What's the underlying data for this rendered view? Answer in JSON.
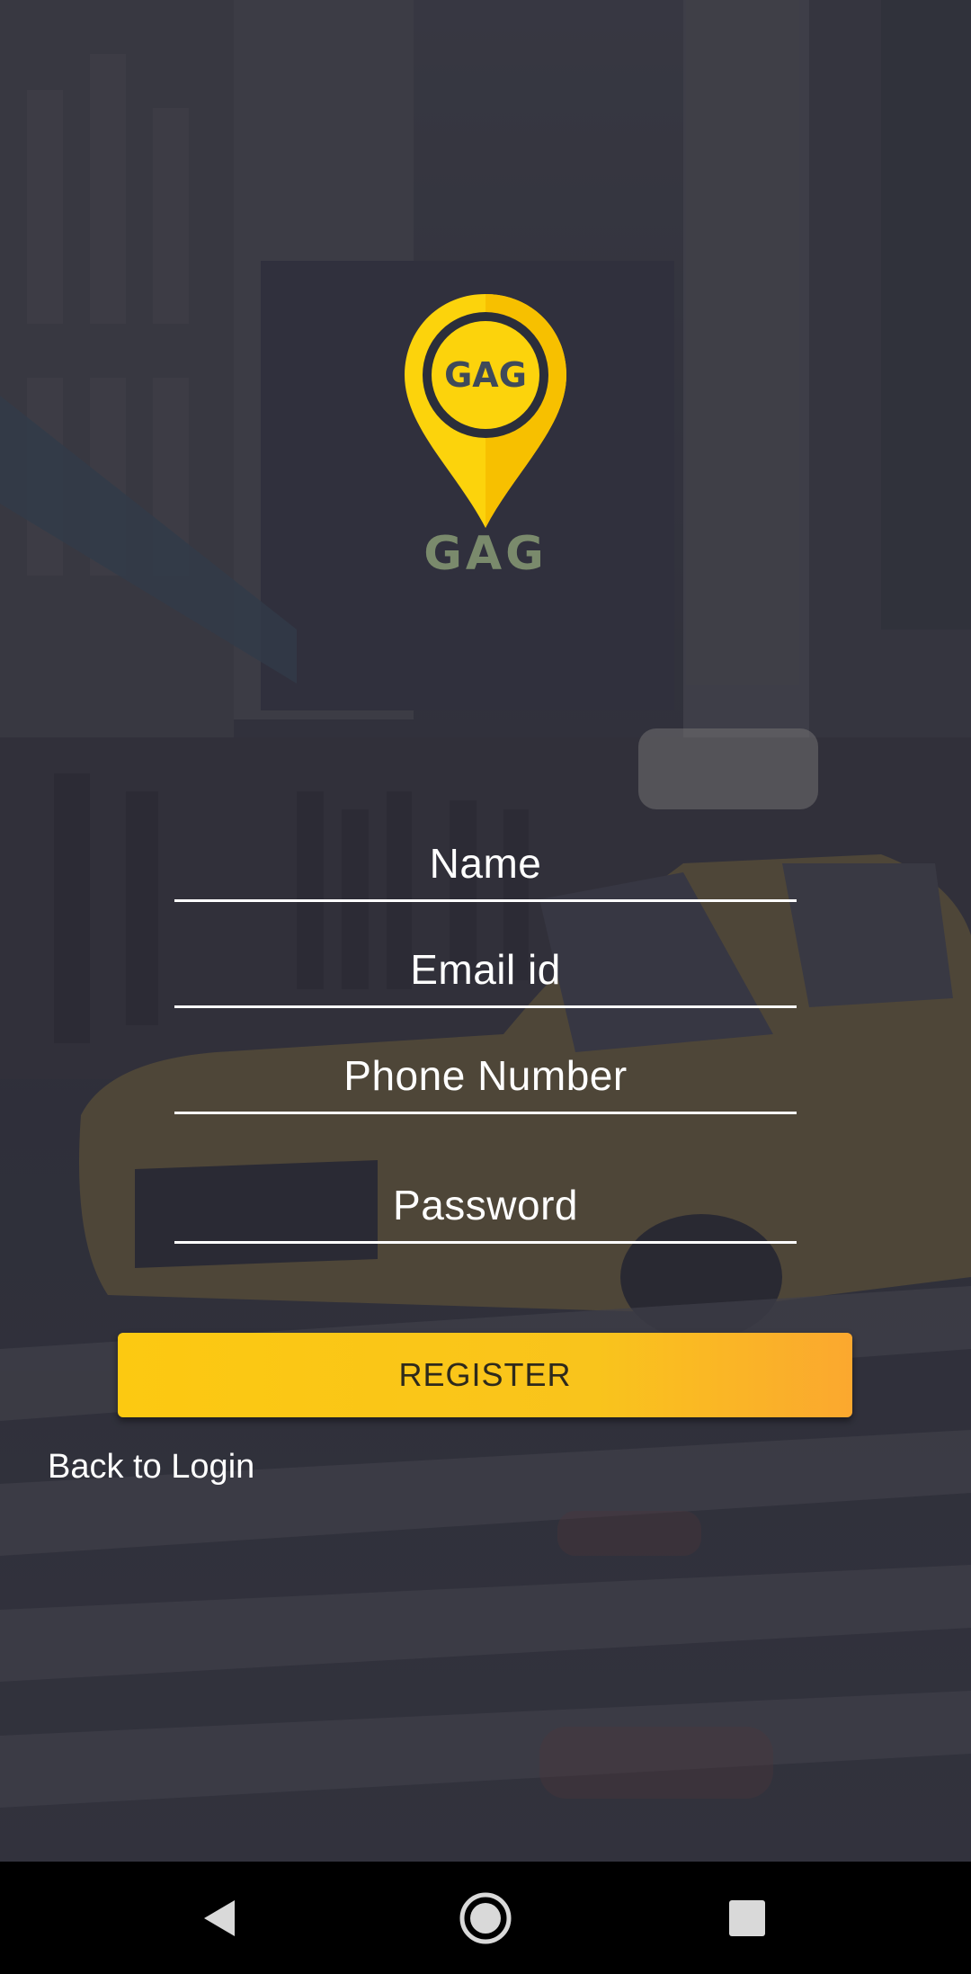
{
  "logo": {
    "badge_text": "GAG",
    "wordmark": "GAG",
    "pin_color": "#fcd30c",
    "ring_color": "#2b2e3a"
  },
  "form": {
    "name_placeholder": "Name",
    "email_placeholder": "Email id",
    "phone_placeholder": "Phone Number",
    "password_placeholder": "Password"
  },
  "actions": {
    "register_label": "REGISTER",
    "back_to_login_label": "Back to Login"
  },
  "colors": {
    "accent": "#fcc911",
    "accent_end": "#fba82f",
    "overlay": "#3b3c44",
    "navbar": "#000000"
  },
  "navbar": {
    "back_icon": "triangle-back-icon",
    "home_icon": "circle-home-icon",
    "recent_icon": "square-recents-icon"
  }
}
